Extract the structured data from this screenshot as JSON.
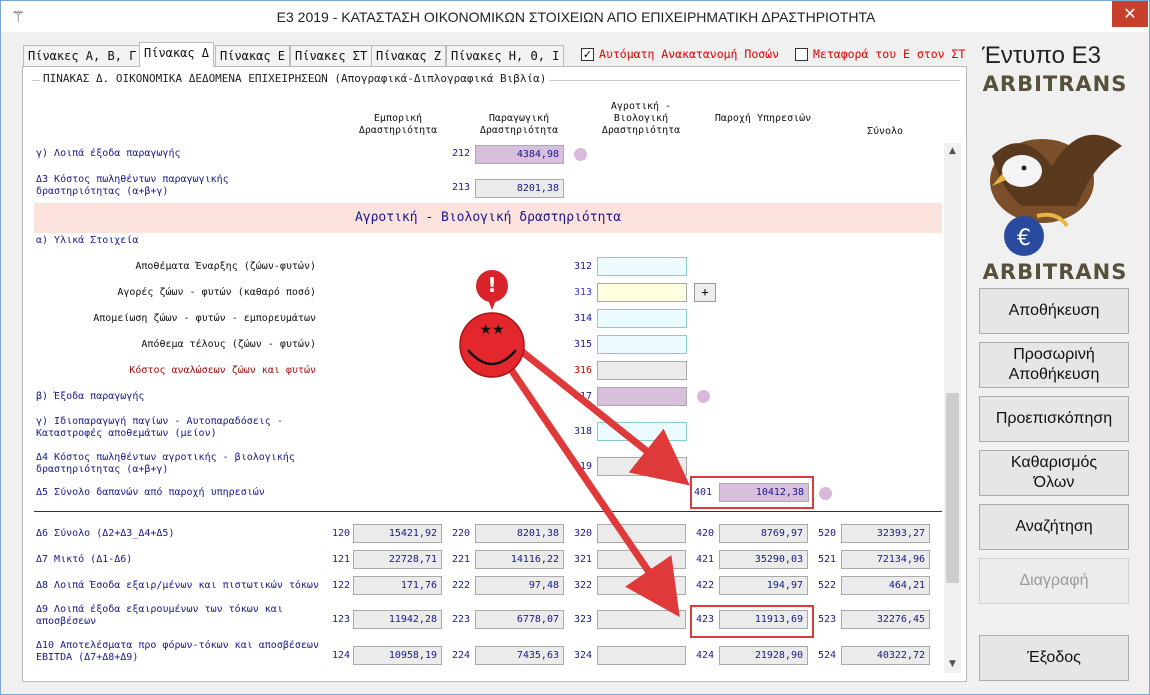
{
  "window": {
    "title": "Ε3 2019 - ΚΑΤΑΣΤΑΣΗ ΟΙΚΟΝΟΜΙΚΩΝ ΣΤΟΙΧΕΙΩΝ ΑΠΟ ΕΠΙΧΕΙΡΗΜΑΤΙΚΗ ΔΡΑΣΤΗΡΙΟΤΗΤΑ",
    "close": "✕"
  },
  "tabs": [
    "Πίνακες Α, Β, Γ",
    "Πίνακας Δ",
    "Πίνακας Ε",
    "Πίνακες ΣΤ",
    "Πίνακας Ζ",
    "Πίνακες Η, Θ, Ι"
  ],
  "options": {
    "auto": "Αυτόματη Ανακατανομή Ποσών",
    "auto_checked": "✓",
    "transfer": "Μεταφορά του Ε στον ΣΤ"
  },
  "group_title": "ΠΙΝΑΚΑΣ Δ. ΟΙΚΟΝΟΜΙΚΑ ΔΕΔΟΜΕΝΑ ΕΠΙΧΕΙΡΗΣΕΩΝ (Απογραφικά-Διπλογραφικά Βιβλία)",
  "columns": [
    "Εμπορική Δραστηριότητα",
    "Παραγωγική Δραστηριότητα",
    "Αγροτική - Βιολογική Δραστηριότητα",
    "Παροχή Υπηρεσιών",
    "Σύνολο"
  ],
  "rows_top": [
    {
      "label": "γ) Λοιπά έξοδα παραγωγής",
      "code": "212",
      "value": "4384,98"
    },
    {
      "label": "Δ3 Κόστος πωληθέντων παραγωγικής δραστηριότητας (α+β+γ)",
      "code": "213",
      "value": "8201,38"
    }
  ],
  "section": "Αγροτική - Βιολογική δραστηριότητα",
  "agro": {
    "a_label": "α) Υλικά Στοιχεία",
    "items": [
      {
        "label": "Αποθέματα Έναρξης (ζώων-φυτών)",
        "code": "312"
      },
      {
        "label": "Αγορές ζώων - φυτών (καθαρό ποσό)",
        "code": "313"
      },
      {
        "label": "Απομείωση ζώων - φυτών - εμπορευμάτων",
        "code": "314"
      },
      {
        "label": "Απόθεμα τέλους (ζώων - φυτών)",
        "code": "315"
      },
      {
        "label": "Κόστος αναλώσεων ζώων και φυτών",
        "code": "316"
      }
    ],
    "plus": "+",
    "b_label": "β) Έξοδα παραγωγής",
    "b_code": "317",
    "g_label": "γ) Ιδιοπαραγωγή παγίων - Αυτοπαραδόσεις - Καταστροφές αποθεμάτων (μείον)",
    "g_code": "318",
    "d4_label": "Δ4 Κόστος πωληθέντων αγροτικής - βιολογικής δραστηριότητας (α+β+γ)",
    "d4_code": "319"
  },
  "d5": {
    "label": "Δ5 Σύνολο δαπανών από παροχή υπηρεσιών",
    "code": "401",
    "value": "10412,38"
  },
  "summary": [
    {
      "label": "Δ6 Σύνολο (Δ2+Δ3_Δ4+Δ5)",
      "c": [
        "120",
        "220",
        "320",
        "420",
        "520"
      ],
      "v": [
        "15421,92",
        "8201,38",
        "",
        "8769,97",
        "32393,27"
      ]
    },
    {
      "label": "Δ7 Μικτό (Δ1-Δ6)",
      "c": [
        "121",
        "221",
        "321",
        "421",
        "521"
      ],
      "v": [
        "22728,71",
        "14116,22",
        "",
        "35290,03",
        "72134,96"
      ]
    },
    {
      "label": "Δ8 Λοιπά Έσοδα εξαιρ/μένων και πιστωτικών τόκων",
      "c": [
        "122",
        "222",
        "322",
        "422",
        "522"
      ],
      "v": [
        "171,76",
        "97,48",
        "",
        "194,97",
        "464,21"
      ]
    },
    {
      "label": "Δ9 Λοιπά έξοδα εξαιρουμένων των τόκων και αποσβέσεων",
      "c": [
        "123",
        "223",
        "323",
        "423",
        "523"
      ],
      "v": [
        "11942,28",
        "6778,07",
        "",
        "11913,69",
        "32276,45"
      ]
    },
    {
      "label": "Δ10 Αποτελέσματα προ φόρων-τόκων και αποσβέσεων EBITDA (Δ7+Δ8+Δ9)",
      "c": [
        "124",
        "224",
        "324",
        "424",
        "524"
      ],
      "v": [
        "10958,19",
        "7435,63",
        "",
        "21928,90",
        "40322,72"
      ]
    }
  ],
  "annotation": {
    "alert": "!",
    "eyes": "★★"
  },
  "sidebar": {
    "title": "Έντυπο Ε3",
    "brand": "ARBITRANS",
    "buttons": [
      "Αποθήκευση",
      "Προσωρινή Αποθήκευση",
      "Προεπισκόπηση",
      "Καθαρισμός Όλων",
      "Αναζήτηση",
      "Διαγραφή",
      "Έξοδος"
    ]
  }
}
